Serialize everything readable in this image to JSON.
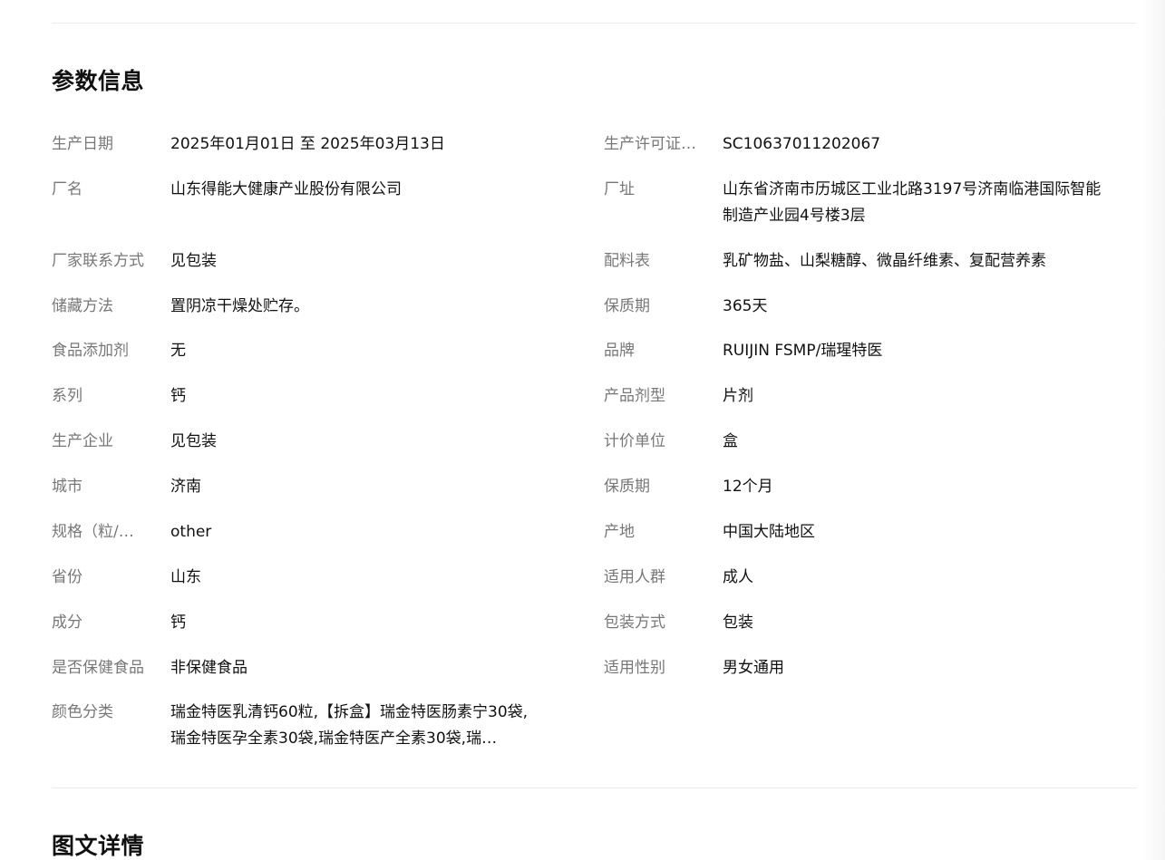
{
  "sections": {
    "params_title": "参数信息",
    "details_title": "图文详情"
  },
  "params": {
    "left": [
      {
        "label": "生产日期",
        "value": "2025年01月01日 至 2025年03月13日"
      },
      {
        "label": "厂名",
        "value": "山东得能大健康产业股份有限公司"
      },
      {
        "label": "厂家联系方式",
        "value": "见包装"
      },
      {
        "label": "储藏方法",
        "value": "置阴凉干燥处贮存。"
      },
      {
        "label": "食品添加剂",
        "value": "无"
      },
      {
        "label": "系列",
        "value": "钙"
      },
      {
        "label": "生产企业",
        "value": "见包装"
      },
      {
        "label": "城市",
        "value": "济南"
      },
      {
        "label": "规格（粒/…",
        "value": "other"
      },
      {
        "label": "省份",
        "value": "山东"
      },
      {
        "label": "成分",
        "value": "钙"
      },
      {
        "label": "是否保健食品",
        "value": "非保健食品"
      },
      {
        "label": "颜色分类",
        "value": "瑞金特医乳清钙60粒,【拆盒】瑞金特医肠素宁30袋,瑞金特医孕全素30袋,瑞金特医产全素30袋,瑞…"
      }
    ],
    "right": [
      {
        "label": "生产许可证…",
        "value": "SC10637011202067"
      },
      {
        "label": "厂址",
        "value": "山东省济南市历城区工业北路3197号济南临港国际智能制造产业园4号楼3层"
      },
      {
        "label": "配料表",
        "value": "乳矿物盐、山梨糖醇、微晶纤维素、复配营养素"
      },
      {
        "label": "保质期",
        "value": "365天"
      },
      {
        "label": "品牌",
        "value": "RUIJIN FSMP/瑞瑆特医"
      },
      {
        "label": "产品剂型",
        "value": "片剂"
      },
      {
        "label": "计价单位",
        "value": "盒"
      },
      {
        "label": "保质期",
        "value": "12个月"
      },
      {
        "label": "产地",
        "value": "中国大陆地区"
      },
      {
        "label": "适用人群",
        "value": "成人"
      },
      {
        "label": "包装方式",
        "value": "包装"
      },
      {
        "label": "适用性别",
        "value": "男女通用"
      }
    ]
  }
}
